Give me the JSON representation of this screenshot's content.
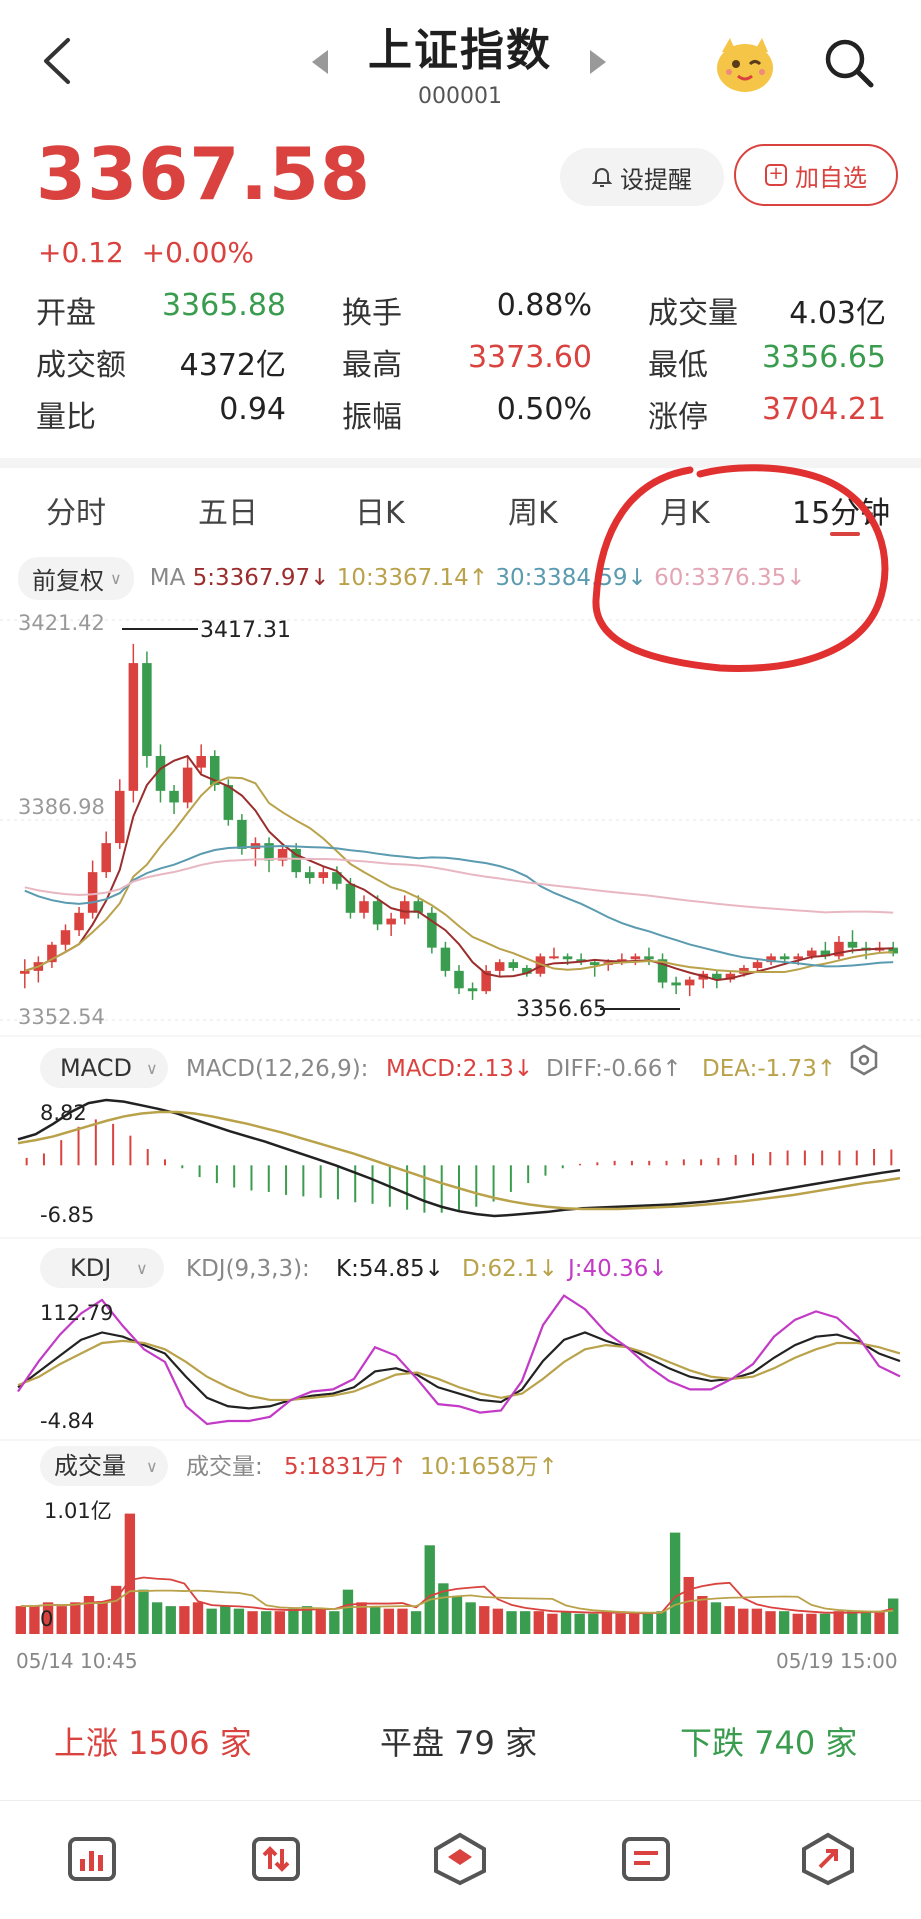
{
  "header": {
    "title": "上证指数",
    "code": "000001"
  },
  "quote": {
    "price": "3367.58",
    "change": "+0.12",
    "change_pct": "+0.00%",
    "alert_label": "设提醒",
    "favorite_label": "加自选"
  },
  "stats": [
    [
      {
        "k": "开盘",
        "v": "3365.88",
        "c": "green"
      },
      {
        "k": "换手",
        "v": "0.88%",
        "c": "dark"
      },
      {
        "k": "成交量",
        "v": "4.03亿",
        "c": "dark"
      }
    ],
    [
      {
        "k": "成交额",
        "v": "4372亿",
        "c": "dark"
      },
      {
        "k": "最高",
        "v": "3373.60",
        "c": "red"
      },
      {
        "k": "最低",
        "v": "3356.65",
        "c": "green"
      }
    ],
    [
      {
        "k": "量比",
        "v": "0.94",
        "c": "dark"
      },
      {
        "k": "振幅",
        "v": "0.50%",
        "c": "dark"
      },
      {
        "k": "涨停",
        "v": "3704.21",
        "c": "red"
      }
    ]
  ],
  "tabs": [
    "分时",
    "五日",
    "日K",
    "周K",
    "月K",
    "15分钟"
  ],
  "active_tab": "15分钟",
  "ma_bar": {
    "adjust": "前复权",
    "ma_label": "MA",
    "ma5": "5:3367.97↓",
    "ma10": "10:3367.14↑",
    "ma30": "30:3384.59↓",
    "ma60": "60:3376.35↓"
  },
  "kline": {
    "y_top": "3421.42",
    "y_mid": "3386.98",
    "y_bottom": "3352.54",
    "high_mark": "3417.31",
    "low_mark": "3356.65"
  },
  "macd": {
    "label": "MACD",
    "params": "MACD(12,26,9):",
    "macd": "MACD:2.13↓",
    "diff": "DIFF:-0.66↑",
    "dea": "DEA:-1.73↑",
    "y_top": "8.82",
    "y_bottom": "-6.85"
  },
  "kdj": {
    "label": "KDJ",
    "params": "KDJ(9,3,3):",
    "k": "K:54.85↓",
    "d": "D:62.1↓",
    "j": "J:40.36↓",
    "y_top": "112.79",
    "y_bottom": "-4.84"
  },
  "volume": {
    "label": "成交量",
    "title": "成交量:",
    "v5": "5:1831万↑",
    "v10": "10:1658万↑",
    "y_top": "1.01亿",
    "y_bottom": "0",
    "x_start": "05/14 10:45",
    "x_end": "05/19 15:00"
  },
  "breadth": {
    "up": "上涨 1506 家",
    "flat": "平盘 79 家",
    "down": "下跌 740 家"
  },
  "colors": {
    "up": "#d9423e",
    "down": "#3a9c4e",
    "ma5": "#9b2d2d",
    "ma10": "#b9a24a",
    "ma30": "#5a9bb0",
    "ma60": "#e8b7c2"
  },
  "chart_data": [
    {
      "type": "candlestick",
      "title": "上证指数 15分钟",
      "ylim": [
        3352.54,
        3421.42
      ],
      "annotations": [
        "3417.31",
        "3356.65"
      ],
      "ohlc": [
        [
          3360.5,
          3363.0,
          3358.0,
          3361.0
        ],
        [
          3361.0,
          3363.5,
          3359.0,
          3362.5
        ],
        [
          3362.5,
          3366.0,
          3361.5,
          3365.5
        ],
        [
          3365.5,
          3369.0,
          3364.5,
          3368.0
        ],
        [
          3368.0,
          3372.0,
          3367.0,
          3371.0
        ],
        [
          3371.0,
          3380.0,
          3370.0,
          3378.0
        ],
        [
          3378.0,
          3385.0,
          3377.0,
          3383.0
        ],
        [
          3383.0,
          3394.0,
          3382.0,
          3392.0
        ],
        [
          3392.0,
          3417.31,
          3390.0,
          3414.0
        ],
        [
          3414.0,
          3416.0,
          3396.0,
          3398.0
        ],
        [
          3398.0,
          3400.0,
          3390.0,
          3392.0
        ],
        [
          3392.0,
          3393.0,
          3388.0,
          3390.0
        ],
        [
          3390.0,
          3398.0,
          3389.0,
          3396.0
        ],
        [
          3396.0,
          3400.0,
          3395.0,
          3398.0
        ],
        [
          3398.0,
          3399.0,
          3392.0,
          3393.0
        ],
        [
          3393.0,
          3394.0,
          3386.0,
          3387.0
        ],
        [
          3387.0,
          3388.0,
          3381.0,
          3382.0
        ],
        [
          3382.0,
          3384.0,
          3379.0,
          3383.0
        ],
        [
          3383.0,
          3384.0,
          3378.0,
          3380.0
        ],
        [
          3380.0,
          3383.0,
          3379.0,
          3382.0
        ],
        [
          3382.0,
          3383.0,
          3377.0,
          3378.0
        ],
        [
          3378.0,
          3379.0,
          3376.0,
          3377.0
        ],
        [
          3377.0,
          3379.0,
          3376.0,
          3378.0
        ],
        [
          3378.0,
          3379.0,
          3375.0,
          3376.0
        ],
        [
          3376.0,
          3377.0,
          3370.0,
          3371.0
        ],
        [
          3371.0,
          3374.0,
          3370.0,
          3373.0
        ],
        [
          3373.0,
          3374.0,
          3368.0,
          3369.0
        ],
        [
          3369.0,
          3371.0,
          3367.0,
          3370.0
        ],
        [
          3370.0,
          3374.0,
          3369.0,
          3373.0
        ],
        [
          3373.0,
          3374.0,
          3370.0,
          3371.0
        ],
        [
          3371.0,
          3372.0,
          3364.0,
          3365.0
        ],
        [
          3365.0,
          3366.0,
          3360.0,
          3361.0
        ],
        [
          3361.0,
          3362.0,
          3357.0,
          3358.0
        ],
        [
          3358.0,
          3359.0,
          3356.0,
          3357.5
        ],
        [
          3357.5,
          3362.0,
          3357.0,
          3361.0
        ],
        [
          3361.0,
          3363.0,
          3360.0,
          3362.5
        ],
        [
          3362.5,
          3363.0,
          3361.0,
          3361.5
        ],
        [
          3361.5,
          3362.0,
          3360.0,
          3360.5
        ],
        [
          3360.5,
          3364.0,
          3360.0,
          3363.5
        ],
        [
          3363.5,
          3365.0,
          3363.0,
          3363.5
        ],
        [
          3363.5,
          3364.0,
          3362.0,
          3363.0
        ],
        [
          3363.0,
          3364.0,
          3362.0,
          3362.5
        ],
        [
          3362.5,
          3363.0,
          3360.0,
          3362.0
        ],
        [
          3362.0,
          3363.0,
          3361.0,
          3362.5
        ],
        [
          3362.5,
          3364.0,
          3362.0,
          3363.0
        ],
        [
          3363.0,
          3364.0,
          3362.0,
          3363.5
        ],
        [
          3363.5,
          3365.0,
          3362.0,
          3363.0
        ],
        [
          3363.0,
          3364.0,
          3358.0,
          3359.0
        ],
        [
          3359.0,
          3360.0,
          3357.0,
          3358.5
        ],
        [
          3358.5,
          3360.0,
          3356.65,
          3359.5
        ],
        [
          3359.5,
          3361.0,
          3358.0,
          3360.5
        ],
        [
          3360.5,
          3361.0,
          3358.0,
          3359.5
        ],
        [
          3359.5,
          3361.0,
          3359.0,
          3360.5
        ],
        [
          3360.5,
          3362.0,
          3360.0,
          3361.5
        ],
        [
          3361.5,
          3363.0,
          3361.0,
          3362.5
        ],
        [
          3362.5,
          3364.0,
          3362.0,
          3363.5
        ],
        [
          3363.5,
          3364.0,
          3362.0,
          3363.0
        ],
        [
          3363.0,
          3364.0,
          3362.0,
          3363.5
        ],
        [
          3363.5,
          3365.0,
          3363.0,
          3364.5
        ],
        [
          3364.5,
          3366.0,
          3363.0,
          3363.5
        ],
        [
          3363.5,
          3367.0,
          3363.0,
          3366.0
        ],
        [
          3366.0,
          3368.0,
          3364.0,
          3365.0
        ],
        [
          3365.0,
          3366.0,
          3363.0,
          3364.5
        ],
        [
          3364.5,
          3366.0,
          3364.0,
          3365.0
        ],
        [
          3365.0,
          3366.0,
          3363.5,
          3364.0
        ]
      ]
    },
    {
      "type": "line",
      "title": "MACD(12,26,9)",
      "ylim": [
        -6.85,
        8.82
      ],
      "series": [
        {
          "name": "DIFF",
          "values": [
            3.5,
            4.2,
            5.6,
            7.2,
            8.4,
            8.82,
            8.6,
            8.1,
            7.6,
            7.0,
            6.2,
            5.4,
            4.6,
            3.9,
            3.2,
            2.4,
            1.6,
            0.8,
            0.0,
            -0.9,
            -1.8,
            -2.8,
            -3.8,
            -4.8,
            -5.6,
            -6.2,
            -6.6,
            -6.85,
            -6.7,
            -6.5,
            -6.3,
            -6.0,
            -5.8,
            -5.7,
            -5.6,
            -5.5,
            -5.4,
            -5.3,
            -5.1,
            -4.9,
            -4.6,
            -4.2,
            -3.8,
            -3.4,
            -3.0,
            -2.6,
            -2.2,
            -1.8,
            -1.4,
            -1.0,
            -0.66
          ]
        },
        {
          "name": "DEA",
          "values": [
            3.0,
            3.4,
            3.9,
            4.6,
            5.3,
            6.0,
            6.6,
            7.0,
            7.2,
            7.2,
            7.0,
            6.6,
            6.1,
            5.6,
            5.0,
            4.4,
            3.7,
            3.0,
            2.3,
            1.6,
            0.8,
            0.0,
            -0.8,
            -1.6,
            -2.4,
            -3.1,
            -3.8,
            -4.4,
            -4.9,
            -5.3,
            -5.6,
            -5.8,
            -5.9,
            -5.9,
            -5.9,
            -5.8,
            -5.7,
            -5.6,
            -5.5,
            -5.3,
            -5.1,
            -4.9,
            -4.6,
            -4.3,
            -4.0,
            -3.6,
            -3.2,
            -2.8,
            -2.4,
            -2.1,
            -1.73
          ]
        },
        {
          "name": "MACD",
          "values": [
            1.0,
            1.6,
            3.4,
            5.2,
            6.2,
            5.6,
            4.0,
            2.2,
            0.8,
            -0.4,
            -1.6,
            -2.4,
            -3.0,
            -3.4,
            -3.6,
            -4.0,
            -4.2,
            -4.4,
            -4.6,
            -5.0,
            -5.2,
            -5.6,
            -6.0,
            -6.4,
            -6.4,
            -6.2,
            -5.6,
            -4.9,
            -3.6,
            -2.4,
            -1.4,
            -0.4,
            0.2,
            0.4,
            0.6,
            0.6,
            0.6,
            0.6,
            0.8,
            0.8,
            1.0,
            1.4,
            1.6,
            1.8,
            2.0,
            2.0,
            2.0,
            2.0,
            2.0,
            2.2,
            2.13
          ]
        }
      ]
    },
    {
      "type": "line",
      "title": "KDJ(9,3,3)",
      "ylim": [
        -4.84,
        112.79
      ],
      "series": [
        {
          "name": "K",
          "values": [
            30,
            45,
            60,
            75,
            82,
            78,
            70,
            62,
            40,
            20,
            12,
            10,
            12,
            18,
            22,
            24,
            30,
            45,
            48,
            42,
            30,
            24,
            18,
            16,
            28,
            55,
            75,
            82,
            74,
            68,
            58,
            48,
            40,
            36,
            38,
            44,
            58,
            70,
            78,
            80,
            74,
            62,
            54.85
          ]
        },
        {
          "name": "D",
          "values": [
            32,
            40,
            52,
            62,
            72,
            74,
            72,
            66,
            54,
            40,
            30,
            22,
            18,
            18,
            20,
            22,
            26,
            34,
            42,
            44,
            38,
            30,
            24,
            20,
            24,
            38,
            54,
            66,
            70,
            68,
            62,
            54,
            46,
            40,
            38,
            40,
            48,
            58,
            66,
            72,
            72,
            68,
            62.1
          ]
        },
        {
          "name": "J",
          "values": [
            26,
            55,
            80,
            100,
            112.79,
            88,
            66,
            54,
            12,
            -4.84,
            -2,
            -2,
            2,
            18,
            26,
            28,
            38,
            68,
            60,
            38,
            14,
            12,
            6,
            8,
            36,
            89,
            117,
            104,
            82,
            68,
            50,
            36,
            28,
            28,
            38,
            52,
            78,
            94,
            102,
            96,
            78,
            50,
            40.36
          ]
        }
      ]
    },
    {
      "type": "bar",
      "title": "成交量",
      "ylim": [
        0,
        1.01
      ],
      "values": [
        0.22,
        0.22,
        0.25,
        0.22,
        0.25,
        0.3,
        0.25,
        0.38,
        0.95,
        0.35,
        0.25,
        0.22,
        0.22,
        0.25,
        0.2,
        0.22,
        0.2,
        0.18,
        0.18,
        0.18,
        0.2,
        0.22,
        0.2,
        0.18,
        0.35,
        0.25,
        0.22,
        0.2,
        0.2,
        0.18,
        0.7,
        0.4,
        0.3,
        0.25,
        0.22,
        0.2,
        0.18,
        0.18,
        0.18,
        0.16,
        0.18,
        0.16,
        0.16,
        0.18,
        0.16,
        0.16,
        0.16,
        0.18,
        0.8,
        0.45,
        0.3,
        0.25,
        0.22,
        0.2,
        0.2,
        0.18,
        0.18,
        0.16,
        0.16,
        0.16,
        0.18,
        0.18,
        0.18,
        0.18,
        0.28
      ]
    }
  ]
}
